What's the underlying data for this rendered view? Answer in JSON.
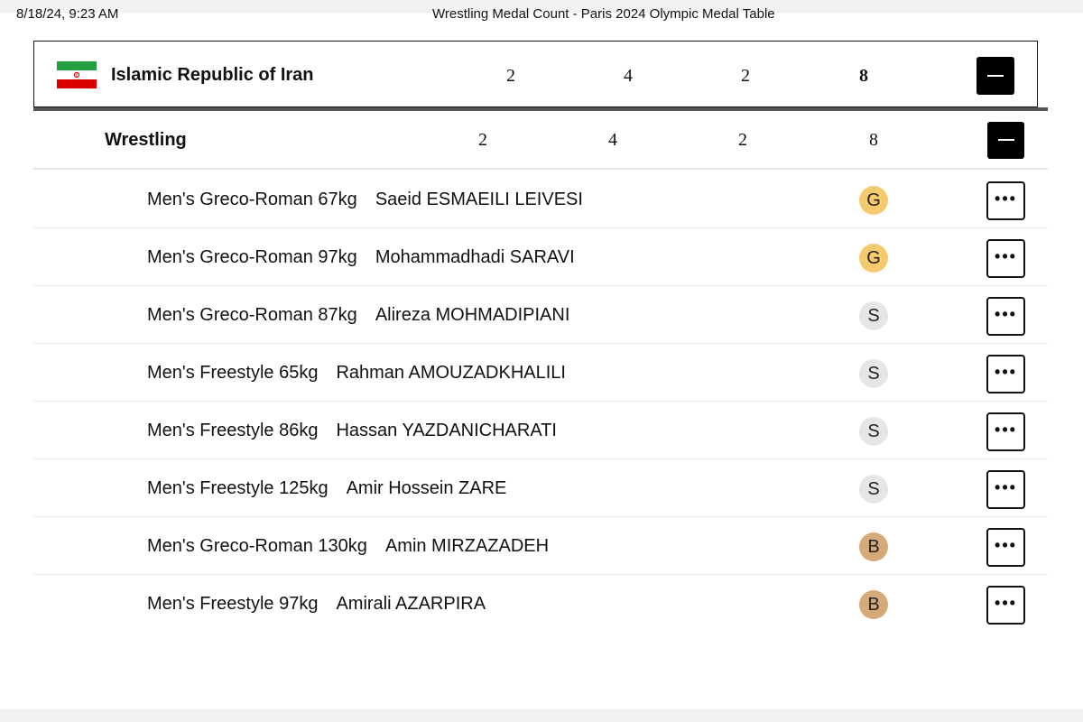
{
  "print_header": {
    "date": "8/18/24, 9:23 AM",
    "title": "Wrestling Medal Count - Paris 2024 Olympic Medal Table"
  },
  "country": {
    "name": "Islamic Republic of Iran",
    "flag_icon": "iran-flag",
    "gold": "2",
    "silver": "4",
    "bronze": "2",
    "total": "8",
    "collapse_icon": "minus-icon"
  },
  "sport": {
    "name": "Wrestling",
    "gold": "2",
    "silver": "4",
    "bronze": "2",
    "total": "8",
    "collapse_icon": "minus-icon"
  },
  "medalists": [
    {
      "event": "Men's Greco-Roman 67kg",
      "athlete": "Saeid ESMAEILI LEIVESI",
      "medal": "G",
      "type": "gold"
    },
    {
      "event": "Men's Greco-Roman 97kg",
      "athlete": "Mohammadhadi SARAVI",
      "medal": "G",
      "type": "gold"
    },
    {
      "event": "Men's Greco-Roman 87kg",
      "athlete": "Alireza MOHMADIPIANI",
      "medal": "S",
      "type": "silver"
    },
    {
      "event": "Men's Freestyle 65kg",
      "athlete": "Rahman AMOUZADKHALILI",
      "medal": "S",
      "type": "silver"
    },
    {
      "event": "Men's Freestyle 86kg",
      "athlete": "Hassan YAZDANICHARATI",
      "medal": "S",
      "type": "silver"
    },
    {
      "event": "Men's Freestyle 125kg",
      "athlete": "Amir Hossein ZARE",
      "medal": "S",
      "type": "silver"
    },
    {
      "event": "Men's Greco-Roman 130kg",
      "athlete": "Amin MIRZAZADEH",
      "medal": "B",
      "type": "bronze"
    },
    {
      "event": "Men's Freestyle 97kg",
      "athlete": "Amirali AZARPIRA",
      "medal": "B",
      "type": "bronze"
    }
  ],
  "row_menu_label": "•••",
  "colors": {
    "gold": "#f5c96d",
    "silver": "#e6e6e6",
    "bronze": "#d6a979",
    "button": "#000000"
  }
}
